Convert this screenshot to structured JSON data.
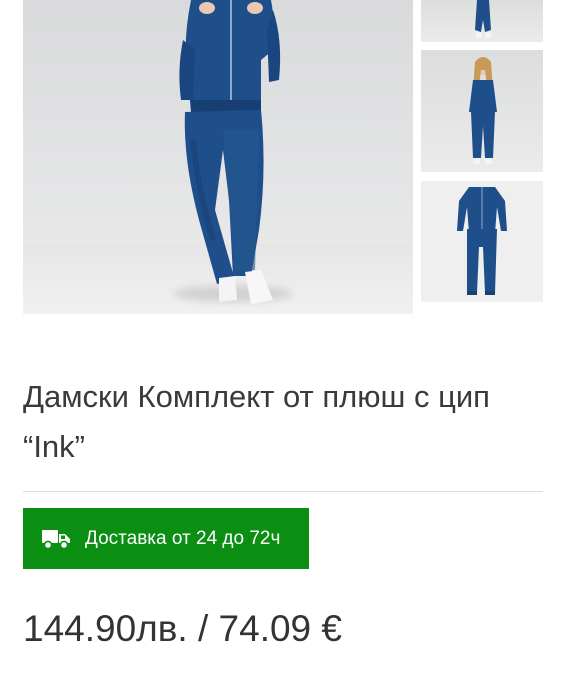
{
  "product": {
    "title": "Дамски Комплект от плюш с цип “Ink”",
    "delivery_label": "Доставка от 24 до 72ч",
    "price": "144.90лв. / 74.09 €"
  },
  "gallery": {
    "main_image": "product-photo",
    "thumbnails": [
      "thumbnail-photo",
      "thumbnail-photo",
      "thumbnail-photo"
    ]
  },
  "icons": {
    "delivery": "truck-icon"
  },
  "colors": {
    "accent": "#0a8f12",
    "garment": "#1f4f8a",
    "text": "#333333"
  }
}
